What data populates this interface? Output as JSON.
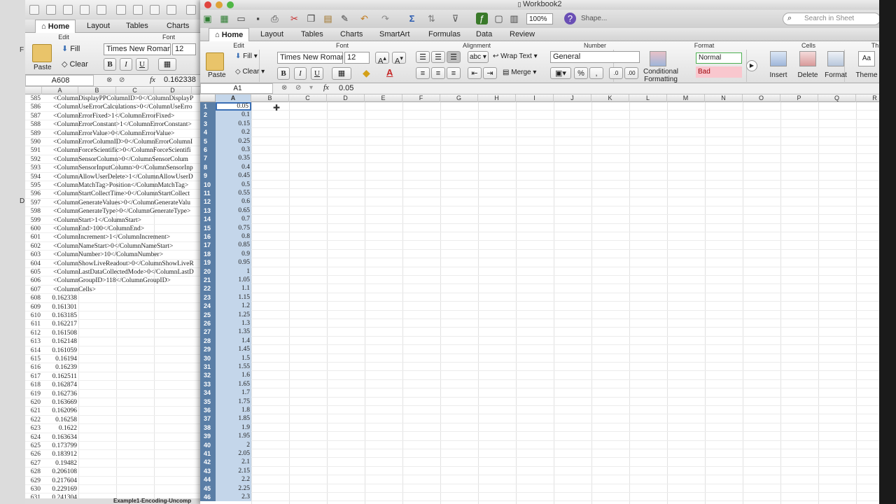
{
  "left_strip": {
    "labels": [
      "F",
      "D"
    ]
  },
  "back_window": {
    "tabs": [
      "Home",
      "Layout",
      "Tables",
      "Charts"
    ],
    "ribbon": {
      "edit_label": "Edit",
      "font_label": "Font",
      "paste": "Paste",
      "fill": "Fill",
      "clear": "Clear",
      "font_name": "Times New Roman",
      "font_size": "12"
    },
    "name_box": "A608",
    "formula_value": "0.162338",
    "columns": [
      "A",
      "B",
      "C",
      "D"
    ],
    "rows": [
      {
        "n": "585",
        "t": "<ColumnDisplayPPColumnID>0</ColumnDisplayP"
      },
      {
        "n": "586",
        "t": "<ColumnUseErrorCalculations>0</ColumnUseErro"
      },
      {
        "n": "587",
        "t": "<ColumnErrorFixed>1</ColumnErrorFixed>"
      },
      {
        "n": "588",
        "t": "<ColumnErrorConstant>1</ColumnErrorConstant>"
      },
      {
        "n": "589",
        "t": "<ColumnErrorValue>0</ColumnErrorValue>"
      },
      {
        "n": "590",
        "t": "<ColumnErrorColumnID>0</ColumnErrorColumnI"
      },
      {
        "n": "591",
        "t": "<ColumnForceScientific>0</ColumnForceScientifi"
      },
      {
        "n": "592",
        "t": "<ColumnSensorColumn>0</ColumnSensorColum"
      },
      {
        "n": "593",
        "t": "<ColumnSensorInputColumn>0</ColumnSensorInp"
      },
      {
        "n": "594",
        "t": "<ColumnAllowUserDelete>1</ColumnAllowUserD"
      },
      {
        "n": "595",
        "t": "<ColumnMatchTag>Position</ColumnMatchTag>"
      },
      {
        "n": "596",
        "t": "<ColumnStartCollectTime>0</ColumnStartCollect"
      },
      {
        "n": "597",
        "t": "<ColumnGenerateValues>0</ColumnGenerateValu"
      },
      {
        "n": "598",
        "t": "<ColumnGenerateType>0</ColumnGenerateType>"
      },
      {
        "n": "599",
        "t": "<ColumnStart>1</ColumnStart>"
      },
      {
        "n": "600",
        "t": "<ColumnEnd>100</ColumnEnd>"
      },
      {
        "n": "601",
        "t": "<ColumnIncrement>1</ColumnIncrement>"
      },
      {
        "n": "602",
        "t": "<ColumnNameStart>0</ColumnNameStart>"
      },
      {
        "n": "603",
        "t": "<ColumnNumber>10</ColumnNumber>"
      },
      {
        "n": "604",
        "t": "<ColumnShowLiveReadout>0</ColumnShowLiveR"
      },
      {
        "n": "605",
        "t": "<ColumnLastDataCollectedMode>0</ColumnLastD"
      },
      {
        "n": "606",
        "t": "<ColumnGroupID>118</ColumnGroupID>"
      },
      {
        "n": "607",
        "t": "<ColumnCells>"
      },
      {
        "n": "608",
        "v": "0.162338"
      },
      {
        "n": "609",
        "v": "0.161301"
      },
      {
        "n": "610",
        "v": "0.163185"
      },
      {
        "n": "611",
        "v": "0.162217"
      },
      {
        "n": "612",
        "v": "0.161508"
      },
      {
        "n": "613",
        "v": "0.162148"
      },
      {
        "n": "614",
        "v": "0.161059"
      },
      {
        "n": "615",
        "v": "0.16194"
      },
      {
        "n": "616",
        "v": "0.16239"
      },
      {
        "n": "617",
        "v": "0.162511"
      },
      {
        "n": "618",
        "v": "0.162874"
      },
      {
        "n": "619",
        "v": "0.162736"
      },
      {
        "n": "620",
        "v": "0.163669"
      },
      {
        "n": "621",
        "v": "0.162096"
      },
      {
        "n": "622",
        "v": "0.16258"
      },
      {
        "n": "623",
        "v": "0.1622"
      },
      {
        "n": "624",
        "v": "0.163634"
      },
      {
        "n": "625",
        "v": "0.173799"
      },
      {
        "n": "626",
        "v": "0.183912"
      },
      {
        "n": "627",
        "v": "0.19482"
      },
      {
        "n": "628",
        "v": "0.206108"
      },
      {
        "n": "629",
        "v": "0.217604"
      },
      {
        "n": "630",
        "v": "0.229169"
      },
      {
        "n": "631",
        "v": "0.241304"
      }
    ],
    "sheet_tab": "Example1-Encoding-Uncomp"
  },
  "front_window": {
    "title": "Workbook2",
    "zoom": "100%",
    "shapes": "Shape...",
    "search_placeholder": "Search in Sheet",
    "tabs": [
      "Home",
      "Layout",
      "Tables",
      "Charts",
      "SmartArt",
      "Formulas",
      "Data",
      "Review"
    ],
    "ribbon": {
      "groups": {
        "edit": "Edit",
        "font": "Font",
        "alignment": "Alignment",
        "number": "Number",
        "format": "Format",
        "cells": "Cells",
        "themes": "Th"
      },
      "paste": "Paste",
      "fill": "Fill",
      "clear": "Clear",
      "font_name": "Times New Roman",
      "font_size": "12",
      "abc": "abc",
      "wrap_text": "Wrap Text",
      "merge": "Merge",
      "number_format": "General",
      "conditional": "Conditional",
      "formatting": "Formatting",
      "style_normal": "Normal",
      "style_bad": "Bad",
      "insert": "Insert",
      "delete": "Delete",
      "format_btn": "Format",
      "themes_btn": "Theme",
      "bold": "B",
      "italic": "I",
      "underline": "U",
      "percent": "%",
      "comma": ","
    },
    "name_box": "A1",
    "fx": "fx",
    "formula_value": "0.05",
    "columns": [
      "A",
      "B",
      "C",
      "D",
      "E",
      "F",
      "G",
      "H",
      "I",
      "J",
      "K",
      "L",
      "M",
      "N",
      "O",
      "P",
      "Q",
      "R"
    ],
    "rows": [
      {
        "n": "1",
        "v": "0.05"
      },
      {
        "n": "2",
        "v": "0.1"
      },
      {
        "n": "3",
        "v": "0.15"
      },
      {
        "n": "4",
        "v": "0.2"
      },
      {
        "n": "5",
        "v": "0.25"
      },
      {
        "n": "6",
        "v": "0.3"
      },
      {
        "n": "7",
        "v": "0.35"
      },
      {
        "n": "8",
        "v": "0.4"
      },
      {
        "n": "9",
        "v": "0.45"
      },
      {
        "n": "10",
        "v": "0.5"
      },
      {
        "n": "11",
        "v": "0.55"
      },
      {
        "n": "12",
        "v": "0.6"
      },
      {
        "n": "13",
        "v": "0.65"
      },
      {
        "n": "14",
        "v": "0.7"
      },
      {
        "n": "15",
        "v": "0.75"
      },
      {
        "n": "16",
        "v": "0.8"
      },
      {
        "n": "17",
        "v": "0.85"
      },
      {
        "n": "18",
        "v": "0.9"
      },
      {
        "n": "19",
        "v": "0.95"
      },
      {
        "n": "20",
        "v": "1"
      },
      {
        "n": "21",
        "v": "1.05"
      },
      {
        "n": "22",
        "v": "1.1"
      },
      {
        "n": "23",
        "v": "1.15"
      },
      {
        "n": "24",
        "v": "1.2"
      },
      {
        "n": "25",
        "v": "1.25"
      },
      {
        "n": "26",
        "v": "1.3"
      },
      {
        "n": "27",
        "v": "1.35"
      },
      {
        "n": "28",
        "v": "1.4"
      },
      {
        "n": "29",
        "v": "1.45"
      },
      {
        "n": "30",
        "v": "1.5"
      },
      {
        "n": "31",
        "v": "1.55"
      },
      {
        "n": "32",
        "v": "1.6"
      },
      {
        "n": "33",
        "v": "1.65"
      },
      {
        "n": "34",
        "v": "1.7"
      },
      {
        "n": "35",
        "v": "1.75"
      },
      {
        "n": "36",
        "v": "1.8"
      },
      {
        "n": "37",
        "v": "1.85"
      },
      {
        "n": "38",
        "v": "1.9"
      },
      {
        "n": "39",
        "v": "1.95"
      },
      {
        "n": "40",
        "v": "2"
      },
      {
        "n": "41",
        "v": "2.05"
      },
      {
        "n": "42",
        "v": "2.1"
      },
      {
        "n": "43",
        "v": "2.15"
      },
      {
        "n": "44",
        "v": "2.2"
      },
      {
        "n": "45",
        "v": "2.25"
      },
      {
        "n": "46",
        "v": "2.3"
      }
    ]
  },
  "colors": {
    "row_header_selected": "#5a7ea6",
    "column_selected": "#c4d6ea",
    "selection_border": "#3a6fb5",
    "bad_style": "#f9c7ce",
    "normal_style_border": "#4caf50"
  }
}
